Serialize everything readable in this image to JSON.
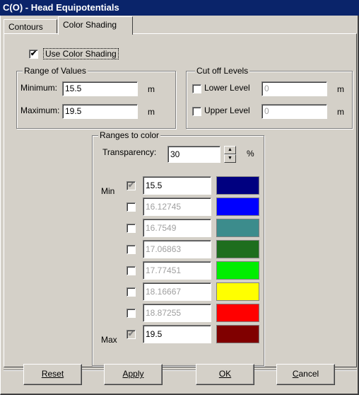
{
  "window": {
    "title": "C(O) - Head Equipotentials"
  },
  "tabs": [
    {
      "label": "Contours"
    },
    {
      "label": "Color Shading"
    }
  ],
  "use_color_shading": {
    "label": "Use Color Shading",
    "checked": true
  },
  "range_of_values": {
    "title": "Range of Values",
    "minimum_label": "Minimum:",
    "minimum_value": "15.5",
    "maximum_label": "Maximum:",
    "maximum_value": "19.5",
    "unit": "m"
  },
  "cutoff_levels": {
    "title": "Cut off Levels",
    "lower_label": "Lower Level",
    "lower_value": "0",
    "upper_label": "Upper Level",
    "upper_value": "0",
    "unit": "m"
  },
  "ranges_to_color": {
    "title": "Ranges to color",
    "transparency_label": "Transparency:",
    "transparency_value": "30",
    "percent": "%",
    "min_label": "Min",
    "max_label": "Max",
    "rows": [
      {
        "value": "15.5",
        "color": "#000080"
      },
      {
        "value": "16.12745",
        "color": "#0000ff"
      },
      {
        "value": "16.7549",
        "color": "#3c8c8c"
      },
      {
        "value": "17.06863",
        "color": "#1e6e1e"
      },
      {
        "value": "17.77451",
        "color": "#00ee00"
      },
      {
        "value": "18.16667",
        "color": "#ffff00"
      },
      {
        "value": "18.87255",
        "color": "#ff0000"
      },
      {
        "value": "19.5",
        "color": "#800000"
      }
    ]
  },
  "buttons": {
    "reset": "Reset",
    "apply": "Apply",
    "ok": "OK",
    "cancel_access": "C",
    "cancel_rest": "ancel"
  }
}
